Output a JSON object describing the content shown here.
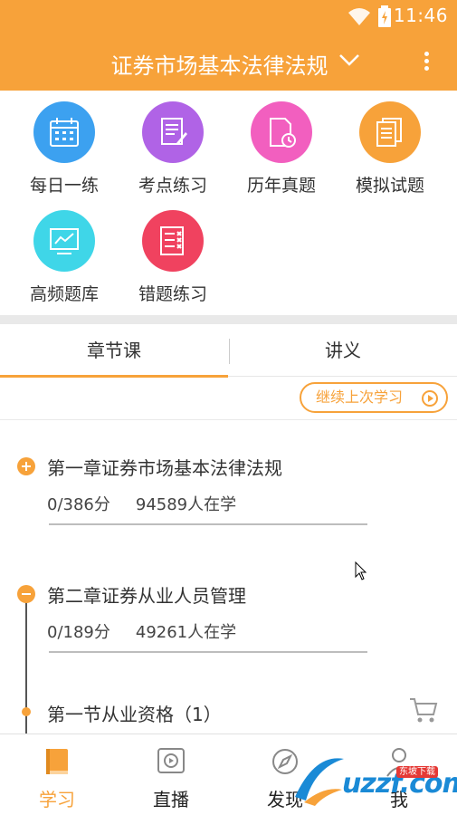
{
  "status_bar": {
    "time": "11:46"
  },
  "header": {
    "title": "证券市场基本法律法规"
  },
  "grid": [
    {
      "label": "每日一练",
      "color": "#3ca1f0",
      "icon": "calendar-icon"
    },
    {
      "label": "考点练习",
      "color": "#b063e6",
      "icon": "notepad-icon"
    },
    {
      "label": "历年真题",
      "color": "#f25fbf",
      "icon": "document-clock-icon"
    },
    {
      "label": "模拟试题",
      "color": "#f7a23a",
      "icon": "papers-icon"
    },
    {
      "label": "高频题库",
      "color": "#3fd6e8",
      "icon": "monitor-chart-icon"
    },
    {
      "label": "错题练习",
      "color": "#f0425f",
      "icon": "checklist-x-icon"
    }
  ],
  "tabs": [
    {
      "label": "章节课"
    },
    {
      "label": "讲义"
    }
  ],
  "continue": {
    "label": "继续上次学习"
  },
  "chapters": [
    {
      "title": "第一章证券市场基本法律法规",
      "score": "0/386分",
      "learners": "94589人在学",
      "state": "collapsed"
    },
    {
      "title": "第二章证券从业人员管理",
      "score": "0/189分",
      "learners": "49261人在学",
      "state": "expanded"
    }
  ],
  "section": {
    "title": "第一节从业资格（1）"
  },
  "bottom_nav": [
    {
      "label": "学习",
      "icon": "book-icon",
      "active": true
    },
    {
      "label": "直播",
      "icon": "video-play-icon",
      "active": false
    },
    {
      "label": "发现",
      "icon": "compass-icon",
      "active": false
    },
    {
      "label": "我",
      "icon": "person-icon",
      "active": false
    }
  ],
  "watermark": {
    "text": "uzzf.com",
    "badge": "东坡下载"
  },
  "colors": {
    "accent": "#f7a23a",
    "text": "#333333"
  }
}
